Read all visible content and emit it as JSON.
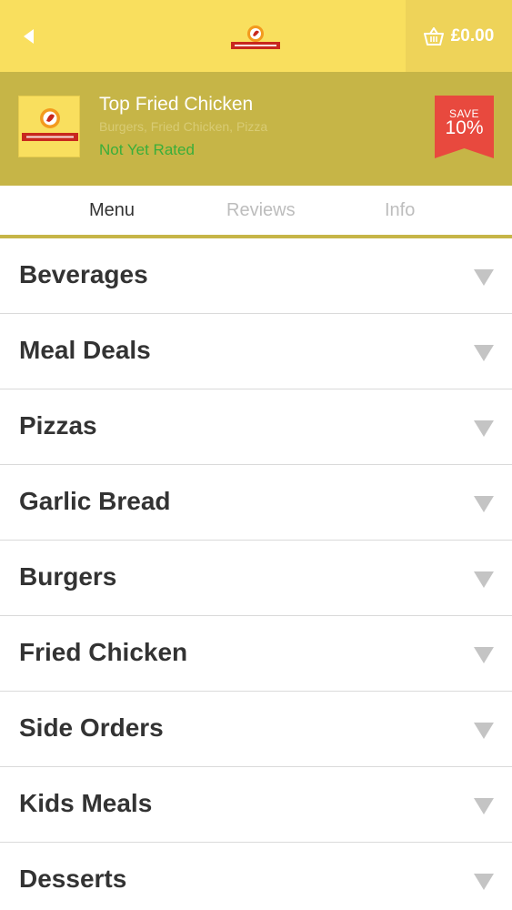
{
  "header": {
    "back_icon": "back-arrow-icon",
    "logo_text": "Top Fried Chicken",
    "basket_icon": "basket-icon",
    "basket_total": "£0.00"
  },
  "restaurant": {
    "name": "Top Fried Chicken",
    "cuisines": "Burgers, Fried Chicken, Pizza",
    "rating_text": "Not Yet Rated",
    "logo_text": "Top Fried Chicken",
    "save_label": "SAVE",
    "save_percent": "10%"
  },
  "tabs": [
    {
      "label": "Menu",
      "active": true
    },
    {
      "label": "Reviews",
      "active": false
    },
    {
      "label": "Info",
      "active": false
    }
  ],
  "categories": [
    {
      "label": "Beverages"
    },
    {
      "label": "Meal Deals"
    },
    {
      "label": "Pizzas"
    },
    {
      "label": "Garlic Bread"
    },
    {
      "label": "Burgers"
    },
    {
      "label": "Fried Chicken"
    },
    {
      "label": "Side Orders"
    },
    {
      "label": "Kids Meals"
    },
    {
      "label": "Desserts"
    }
  ],
  "colors": {
    "header_bg": "#f9df5e",
    "basket_bg": "#eed359",
    "info_band_bg": "#c6b547",
    "rating_green": "#3aae3a",
    "save_red": "#e8493e",
    "text_dark": "#333333",
    "tab_inactive": "#bdbdbd"
  }
}
